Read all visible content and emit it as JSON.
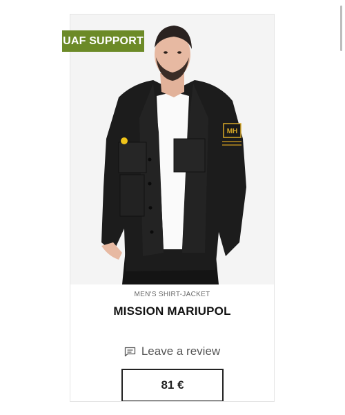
{
  "product": {
    "badge": "UAF SUPPORT",
    "category": "MEN'S SHIRT-JACKET",
    "title": "MISSION MARIUPOL",
    "review_label": "Leave a review",
    "price": "81 €",
    "patch_text": "MH"
  },
  "icons": {
    "review": "message-square-icon"
  },
  "colors": {
    "badge_bg": "#6c8a27",
    "jacket": "#1c1c1c",
    "border": "#222222"
  }
}
